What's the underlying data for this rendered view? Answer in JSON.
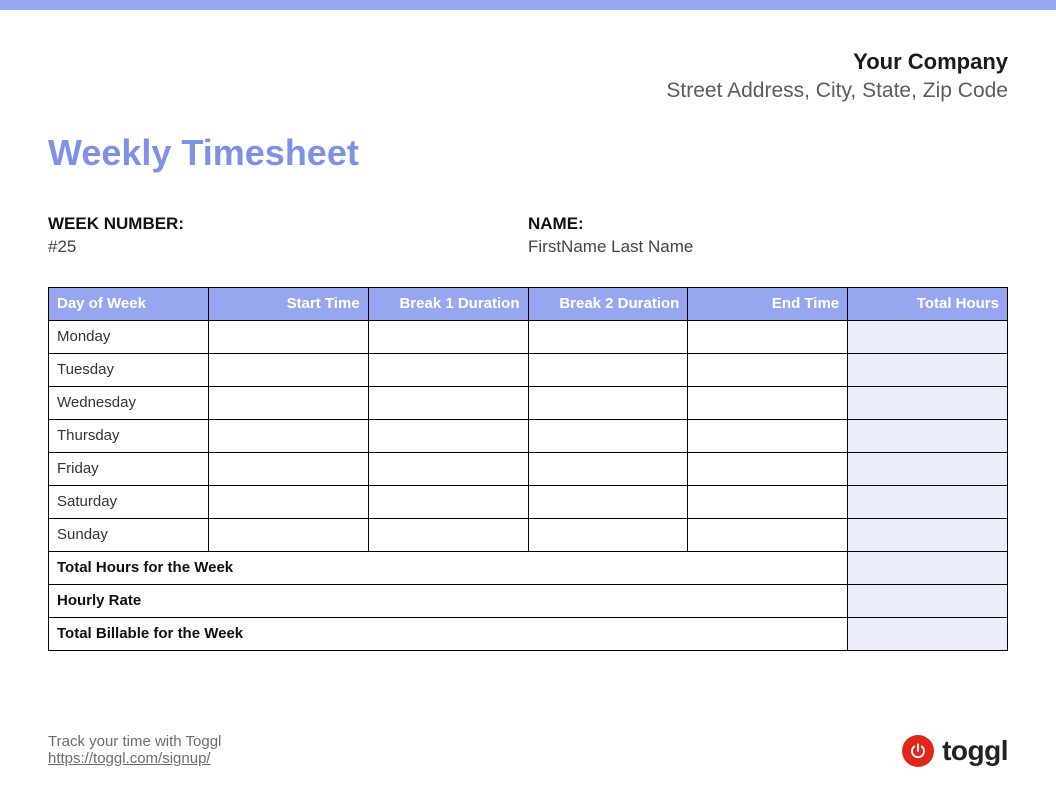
{
  "company": {
    "name": "Your Company",
    "address": "Street Address, City, State, Zip Code"
  },
  "title": "Weekly Timesheet",
  "meta": {
    "week_label": "WEEK NUMBER:",
    "week_value": "#25",
    "name_label": "NAME:",
    "name_value": "FirstName Last Name"
  },
  "table": {
    "headers": {
      "day": "Day of Week",
      "start": "Start Time",
      "break1": "Break 1 Duration",
      "break2": "Break 2 Duration",
      "end": "End Time",
      "total": "Total Hours"
    },
    "days": [
      {
        "name": "Monday",
        "start": "",
        "break1": "",
        "break2": "",
        "end": "",
        "total": ""
      },
      {
        "name": "Tuesday",
        "start": "",
        "break1": "",
        "break2": "",
        "end": "",
        "total": ""
      },
      {
        "name": "Wednesday",
        "start": "",
        "break1": "",
        "break2": "",
        "end": "",
        "total": ""
      },
      {
        "name": "Thursday",
        "start": "",
        "break1": "",
        "break2": "",
        "end": "",
        "total": ""
      },
      {
        "name": "Friday",
        "start": "",
        "break1": "",
        "break2": "",
        "end": "",
        "total": ""
      },
      {
        "name": "Saturday",
        "start": "",
        "break1": "",
        "break2": "",
        "end": "",
        "total": ""
      },
      {
        "name": "Sunday",
        "start": "",
        "break1": "",
        "break2": "",
        "end": "",
        "total": ""
      }
    ],
    "summaries": {
      "total_hours_label": "Total Hours for the Week",
      "total_hours_value": "",
      "hourly_rate_label": "Hourly Rate",
      "hourly_rate_value": "",
      "total_billable_label": "Total Billable for the Week",
      "total_billable_value": ""
    }
  },
  "footer": {
    "tagline": "Track your time with Toggl",
    "link_text": "https://toggl.com/signup/",
    "logo_text": "toggl"
  }
}
